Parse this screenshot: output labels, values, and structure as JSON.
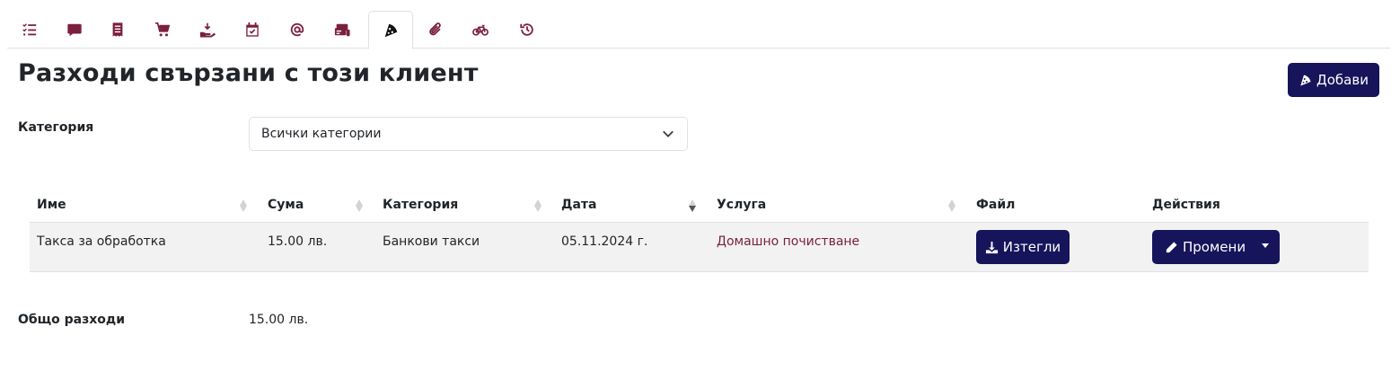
{
  "colors": {
    "accent": "#7a1f3d",
    "primary_button": "#16145a",
    "row_bg": "#f2f2f2",
    "border": "#dee2e6"
  },
  "tabs": [
    {
      "icon": "list-check-icon",
      "active": false
    },
    {
      "icon": "comment-icon",
      "active": false
    },
    {
      "icon": "receipt-icon",
      "active": false
    },
    {
      "icon": "cart-icon",
      "active": false
    },
    {
      "icon": "hand-holding-icon",
      "active": false
    },
    {
      "icon": "calendar-check-icon",
      "active": false
    },
    {
      "icon": "at-sign-icon",
      "active": false
    },
    {
      "icon": "money-cards-icon",
      "active": false
    },
    {
      "icon": "pizza-slice-icon",
      "active": true
    },
    {
      "icon": "paperclip-icon",
      "active": false
    },
    {
      "icon": "bicycle-icon",
      "active": false
    },
    {
      "icon": "history-icon",
      "active": false
    }
  ],
  "page": {
    "title": "Разходи свързани с този клиент",
    "add_label": "Добави"
  },
  "filter": {
    "label": "Категория",
    "selected": "Всички категории"
  },
  "table": {
    "headers": {
      "name": "Име",
      "amount": "Сума",
      "category": "Категория",
      "date": "Дата",
      "service": "Услуга",
      "file": "Файл",
      "actions": "Действия"
    },
    "rows": [
      {
        "name": "Такса за обработка",
        "amount": "15.00 лв.",
        "category": "Банкови такси",
        "date": "05.11.2024 г.",
        "service": "Домашно почистване",
        "download_label": "Изтегли",
        "edit_label": "Промени"
      }
    ]
  },
  "totals": {
    "label": "Общо разходи",
    "value": "15.00 лв."
  }
}
